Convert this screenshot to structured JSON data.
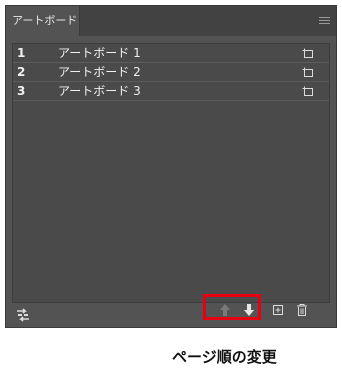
{
  "panel": {
    "tab_label": "アートボード",
    "icons": {
      "menu": "hamburger-menu-icon",
      "reorder": "reorder-artboards-icon",
      "move_up": "arrow-up-icon",
      "move_down": "arrow-down-icon",
      "new": "new-artboard-icon",
      "delete": "trash-icon",
      "row": "artboard-options-icon"
    },
    "colors": {
      "panel_bg": "#535353",
      "list_bg": "#4a4a4a",
      "text": "#f0f0f0",
      "highlight": "#e60012"
    }
  },
  "artboards": [
    {
      "num": "1",
      "name": "アートボード 1"
    },
    {
      "num": "2",
      "name": "アートボード 2"
    },
    {
      "num": "3",
      "name": "アートボード 3"
    }
  ],
  "caption": "ページ順の変更"
}
